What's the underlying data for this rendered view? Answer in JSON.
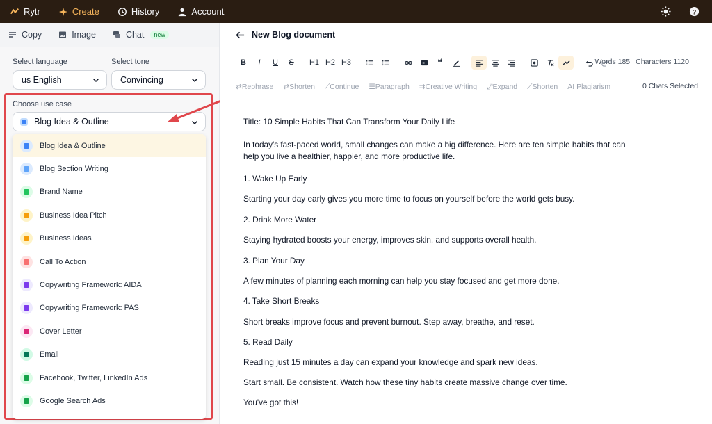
{
  "nav": {
    "brand": "Rytr",
    "create": "Create",
    "history": "History",
    "account": "Account"
  },
  "left_tabs": {
    "copy": "Copy",
    "image": "Image",
    "chat": "Chat",
    "chat_badge": "new"
  },
  "language": {
    "label": "Select language",
    "value": "us English"
  },
  "tone": {
    "label": "Select tone",
    "value": "Convincing"
  },
  "use_case": {
    "label": "Choose use case",
    "value": "Blog Idea & Outline",
    "options": [
      {
        "label": "Blog Idea & Outline",
        "icon": "blog-outline-icon",
        "color": "#3b82f6",
        "bg": "#dbeafe"
      },
      {
        "label": "Blog Section Writing",
        "icon": "blog-section-icon",
        "color": "#60a5fa",
        "bg": "#dbeafe"
      },
      {
        "label": "Brand Name",
        "icon": "brand-name-icon",
        "color": "#22c55e",
        "bg": "#dcfce7"
      },
      {
        "label": "Business Idea Pitch",
        "icon": "pitch-icon",
        "color": "#f59e0b",
        "bg": "#fef3c7"
      },
      {
        "label": "Business Ideas",
        "icon": "lightbulb-icon",
        "color": "#f59e0b",
        "bg": "#fef3c7"
      },
      {
        "label": "Call To Action",
        "icon": "cta-icon",
        "color": "#f87171",
        "bg": "#fee2e2"
      },
      {
        "label": "Copywriting Framework: AIDA",
        "icon": "framework-icon",
        "color": "#7c3aed",
        "bg": "#ede9fe"
      },
      {
        "label": "Copywriting Framework: PAS",
        "icon": "framework-icon",
        "color": "#7c3aed",
        "bg": "#ede9fe"
      },
      {
        "label": "Cover Letter",
        "icon": "cover-letter-icon",
        "color": "#db2777",
        "bg": "#fce7f3"
      },
      {
        "label": "Email",
        "icon": "email-icon",
        "color": "#047857",
        "bg": "#d1fae5"
      },
      {
        "label": "Facebook, Twitter, LinkedIn Ads",
        "icon": "ads-icon",
        "color": "#16a34a",
        "bg": "#dcfce7"
      },
      {
        "label": "Google Search Ads",
        "icon": "search-ads-icon",
        "color": "#16a34a",
        "bg": "#dcfce7"
      }
    ]
  },
  "editor": {
    "title": "New Blog document",
    "toolbar": [
      "B",
      "I",
      "U",
      "S",
      "H1",
      "H2",
      "H3"
    ],
    "words": "Words 185",
    "characters": "Characters 1120",
    "actions": [
      "Rephrase",
      "Shorten",
      "Continue",
      "Paragraph",
      "Creative Writing",
      "Expand",
      "Shorten",
      "AI Plagiarism"
    ],
    "chats_selected": "0 Chats Selected",
    "paragraphs": [
      "Title: 10 Simple Habits That Can Transform Your Daily Life",
      "In today's fast-paced world, small changes can make a big difference. Here are ten simple habits that can help you live a healthier, happier, and more productive life.",
      "1. Wake Up Early",
      "Starting your day early gives you more time to focus on yourself before the world gets busy.",
      "2. Drink More Water",
      "Staying hydrated boosts your energy, improves skin, and supports overall health.",
      "3. Plan Your Day",
      "A few minutes of planning each morning can help you stay focused and get more done.",
      "4. Take Short Breaks",
      "Short breaks improve focus and prevent burnout. Step away, breathe, and reset.",
      "5. Read Daily",
      "Reading just 15 minutes a day can expand your knowledge and spark new ideas.",
      "Start small. Be consistent. Watch how these tiny habits create massive change over time.",
      "You've got this!"
    ]
  },
  "colors": {
    "topbar": "#2a1d12",
    "accent": "#f5b45b",
    "highlight_border": "#e0474c"
  }
}
